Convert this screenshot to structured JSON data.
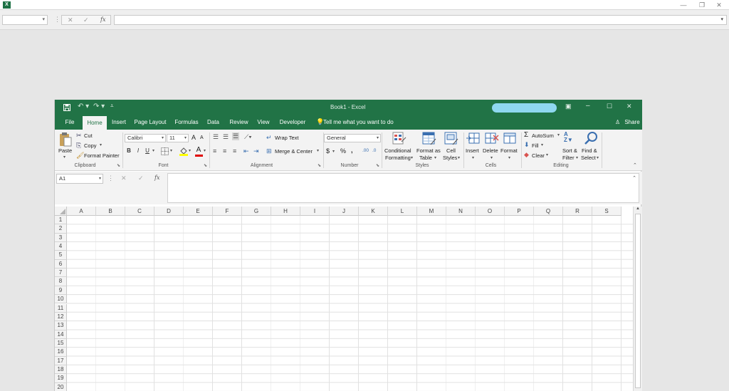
{
  "outer": {
    "logo": "X",
    "window_controls": [
      "—",
      "❐",
      "✕"
    ],
    "formula_bar": {
      "fx": "fx",
      "cancel": "✕",
      "enter": "✓",
      "dropdown_arrow": "▾"
    }
  },
  "title_bar": {
    "title": "Book1  -  Excel",
    "quick_access": [
      "save-icon",
      "undo-icon",
      "redo-icon",
      "customize-icon"
    ],
    "controls": [
      "ribbon-display-icon",
      "minimize-icon",
      "restore-icon",
      "close-icon"
    ]
  },
  "tabs": [
    {
      "label": "File"
    },
    {
      "label": "Home",
      "active": true
    },
    {
      "label": "Insert"
    },
    {
      "label": "Page Layout"
    },
    {
      "label": "Formulas"
    },
    {
      "label": "Data"
    },
    {
      "label": "Review"
    },
    {
      "label": "View"
    },
    {
      "label": "Developer"
    }
  ],
  "tell_me": "Tell me what you want to do",
  "share": "Share",
  "ribbon": {
    "clipboard": {
      "paste": "Paste",
      "cut": "Cut",
      "copy": "Copy",
      "format_painter": "Format Painter",
      "label": "Clipboard"
    },
    "font": {
      "name": "Calibri",
      "size": "11",
      "grow": "A",
      "shrink": "A",
      "bold": "B",
      "italic": "I",
      "underline": "U",
      "font_color_glyph": "A",
      "label": "Font"
    },
    "alignment": {
      "wrap": "Wrap Text",
      "merge": "Merge & Center",
      "label": "Alignment"
    },
    "number": {
      "format": "General",
      "currency": "$",
      "percent": "%",
      "comma": ",",
      "label": "Number"
    },
    "styles": {
      "conditional_1": "Conditional",
      "conditional_2": "Formatting",
      "table_1": "Format as",
      "table_2": "Table",
      "cell_1": "Cell",
      "cell_2": "Styles",
      "label": "Styles"
    },
    "cells": {
      "insert": "Insert",
      "delete": "Delete",
      "format": "Format",
      "label": "Cells"
    },
    "editing": {
      "autosum": "AutoSum",
      "fill": "Fill",
      "clear": "Clear",
      "sort_1": "Sort &",
      "sort_2": "Filter",
      "find_1": "Find &",
      "find_2": "Select",
      "label": "Editing"
    }
  },
  "formula_bar": {
    "name_box": "A1",
    "fx": "fx",
    "cancel": "✕",
    "enter": "✓",
    "value": ""
  },
  "columns": [
    "A",
    "B",
    "C",
    "D",
    "E",
    "F",
    "G",
    "H",
    "I",
    "J",
    "K",
    "L",
    "M",
    "N",
    "O",
    "P",
    "Q",
    "R",
    "S"
  ],
  "rows": [
    "1",
    "2",
    "3",
    "4",
    "5",
    "6",
    "7",
    "8",
    "9",
    "10",
    "11",
    "12",
    "13",
    "14",
    "15",
    "16",
    "17",
    "18",
    "19",
    "20"
  ],
  "colors": {
    "excel_green": "#217346",
    "ribbon_bg": "#f3f3f3",
    "redacted_bar": "#8fd8f0"
  }
}
